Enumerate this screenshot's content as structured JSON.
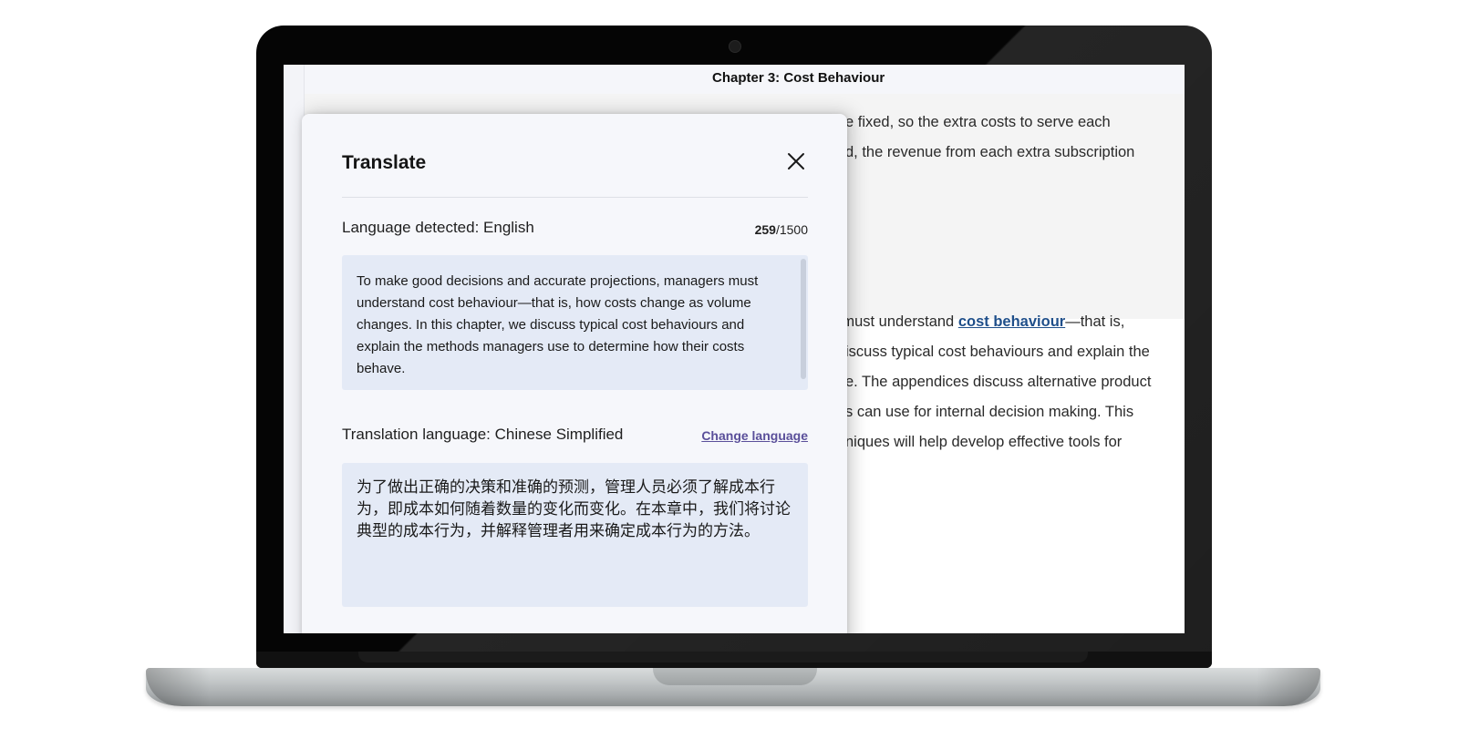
{
  "document": {
    "chapter_title": "Chapter 3: Cost Behaviour",
    "upper_lines": [
      "e fixed, so the extra costs to serve each",
      "d, the revenue from each extra subscription"
    ],
    "lower_line_1_prefix": "rs must understand ",
    "lower_line_1_link": "cost behaviour",
    "lower_line_1_suffix": "—that is,",
    "lower_lines": [
      "iscuss typical cost behaviours and explain the",
      "e. The appendices discuss alternative product",
      "s can use for internal decision making. This",
      "niques will help develop effective tools for"
    ]
  },
  "translate_modal": {
    "title": "Translate",
    "close_icon": "close-icon",
    "language_detected_label": "Language detected: English",
    "char_count_current": "259",
    "char_count_max": "/1500",
    "source_text": "To make good decisions and accurate projections, managers must understand cost behaviour—that is, how costs change as volume changes. In this chapter, we discuss typical cost behaviours and explain the methods managers use to determine how their costs behave.",
    "translation_language_label": "Translation language: Chinese Simplified",
    "change_language_label": "Change language",
    "translated_text": "为了做出正确的决策和准确的预测，管理人员必须了解成本行为，即成本如何随着数量的变化而变化。在本章中，我们将讨论典型的成本行为，并解释管理者用来确定成本行为的方法。"
  },
  "colors": {
    "modal_bg": "#f6f7fb",
    "text_box_bg": "#e4eaf6",
    "link": "#1f4f8a",
    "change_language": "#5a4f9a"
  }
}
